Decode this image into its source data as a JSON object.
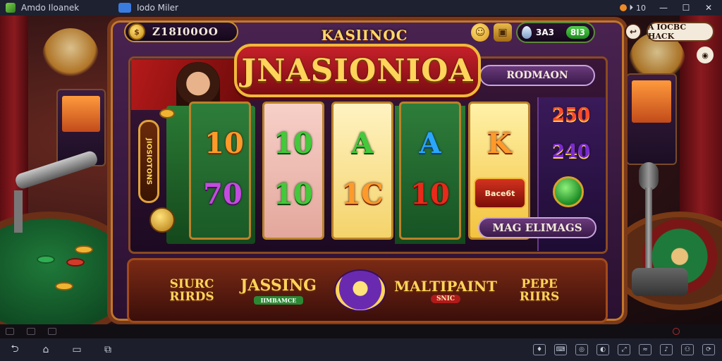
{
  "window": {
    "app_title": "Amdo Iloanek",
    "tab_label": "Iodo Miler",
    "status_value": "10",
    "icons": [
      "minimize-icon",
      "maximize-icon",
      "close-icon"
    ]
  },
  "hud": {
    "balance": "Z18I00OO",
    "coin_glyph": "$",
    "gems_value": "3A3",
    "gems_pill": "8I3",
    "back_label": "A IOCBC HACK"
  },
  "logo": {
    "small": "KASlINOC",
    "big": "JNASIONIOA"
  },
  "reels": {
    "row1": [
      "10",
      "10",
      "A",
      "A",
      "K"
    ],
    "row2": [
      "70",
      "10",
      "1C",
      "10"
    ]
  },
  "side": {
    "value_1": "250",
    "value_2": "240",
    "plate_top": "RODMAON",
    "plate_bottom": "MAG ELIMAGS",
    "small_plate": "Bace6t",
    "left_badge": "JIOSIOTONS"
  },
  "games": [
    {
      "title": "SIURC RIRDS"
    },
    {
      "title": "JASSING",
      "sub": "IIMBAMCE"
    },
    {
      "title": ""
    },
    {
      "title": "MALTIPAINT",
      "sub": "SNIC"
    },
    {
      "title": "PEPE RIIRS"
    }
  ],
  "colors": {
    "frame_border": "#7a3a1a",
    "gold": "#ffd45a",
    "accent_red": "#c7212a"
  }
}
